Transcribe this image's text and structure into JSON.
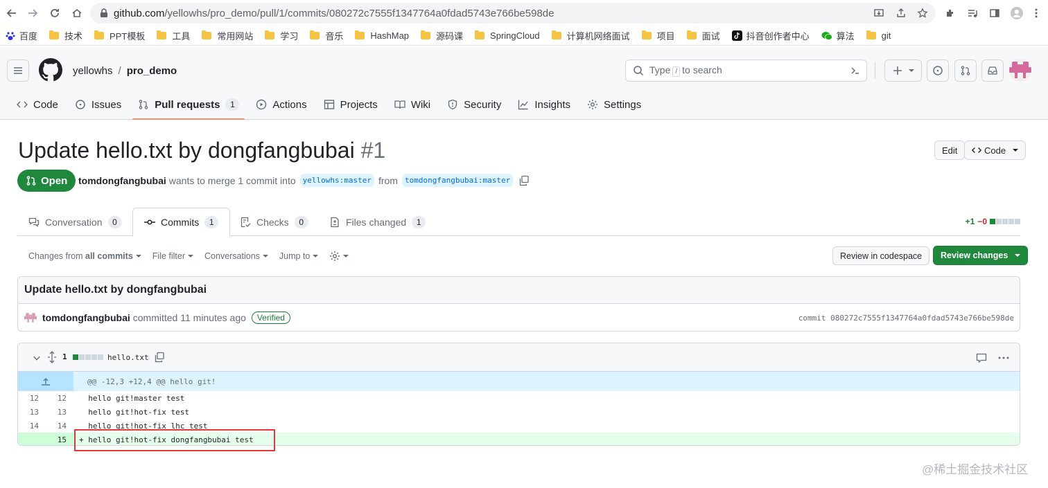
{
  "browser": {
    "url_host": "github.com",
    "url_path": "/yellowhs/pro_demo/pull/1/commits/080272c7555f1347764a0fdad5743e766be598de",
    "bookmarks": [
      "百度",
      "技术",
      "PPT模板",
      "工具",
      "常用网站",
      "学习",
      "音乐",
      "HashMap",
      "源码课",
      "SpringCloud",
      "计算机网络面试",
      "项目",
      "面试",
      "抖音创作者中心",
      "算法",
      "git"
    ]
  },
  "header": {
    "owner": "yellowhs",
    "separator": "/",
    "repo": "pro_demo",
    "search_prefix": "Type",
    "search_key": "/",
    "search_suffix": "to search"
  },
  "repo_nav": [
    {
      "label": "Code",
      "icon": "code-icon"
    },
    {
      "label": "Issues",
      "icon": "issue-icon"
    },
    {
      "label": "Pull requests",
      "icon": "pull-request-icon",
      "count": "1",
      "active": true
    },
    {
      "label": "Actions",
      "icon": "play-icon"
    },
    {
      "label": "Projects",
      "icon": "table-icon"
    },
    {
      "label": "Wiki",
      "icon": "book-icon"
    },
    {
      "label": "Security",
      "icon": "shield-icon"
    },
    {
      "label": "Insights",
      "icon": "graph-icon"
    },
    {
      "label": "Settings",
      "icon": "gear-icon"
    }
  ],
  "pr": {
    "title": "Update hello.txt by dongfangbubai",
    "number": "#1",
    "edit_label": "Edit",
    "code_label": "Code",
    "status": "Open",
    "author": "tomdongfangbubai",
    "merge_text": "wants to merge 1 commit into",
    "base_branch": "yellowhs:master",
    "from_text": "from",
    "head_branch": "tomdongfangbubai:master"
  },
  "tabs": [
    {
      "label": "Conversation",
      "count": "0"
    },
    {
      "label": "Commits",
      "count": "1"
    },
    {
      "label": "Checks",
      "count": "0"
    },
    {
      "label": "Files changed",
      "count": "1"
    }
  ],
  "diffstat": {
    "added": "+1",
    "removed": "−0"
  },
  "toolbar": {
    "changes_prefix": "Changes from",
    "changes_value": "all commits",
    "file_filter": "File filter",
    "conversations": "Conversations",
    "jump_to": "Jump to",
    "review_codespace": "Review in codespace",
    "review_changes": "Review changes"
  },
  "commit": {
    "message": "Update hello.txt by dongfangbubai",
    "author": "tomdongfangbubai",
    "committed_text": "committed 11 minutes ago",
    "verified": "Verified",
    "sha_label": "commit 080272c7555f1347764a0fdad5743e766be598de"
  },
  "file": {
    "changes": "1",
    "name": "hello.txt",
    "hunk": "@@ -12,3 +12,4 @@ hello git!",
    "lines": [
      {
        "old": "12",
        "new": "12",
        "sign": " ",
        "text": "hello git!master test"
      },
      {
        "old": "13",
        "new": "13",
        "sign": " ",
        "text": "hello git!hot-fix test"
      },
      {
        "old": "14",
        "new": "14",
        "sign": " ",
        "text": "hello git!hot-fix lhc test"
      },
      {
        "old": "",
        "new": "15",
        "sign": "+",
        "text": "hello git!hot-fix dongfangbubai test"
      }
    ]
  },
  "watermark": "@稀土掘金技术社区",
  "colors": {
    "accent_green": "#1f883d",
    "link_blue": "#0969da",
    "highlight_red": "#e03a3a"
  }
}
